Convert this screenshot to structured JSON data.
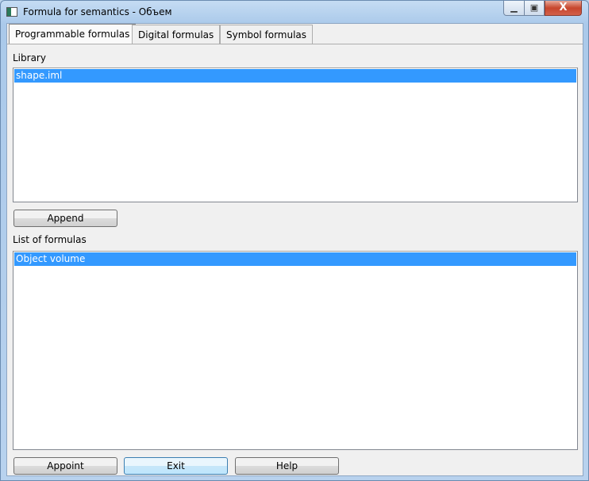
{
  "window": {
    "title": "Formula for semantics - Объем",
    "close_glyph": "X"
  },
  "tabs": [
    {
      "label": "Programmable formulas",
      "active": true
    },
    {
      "label": "Digital formulas"
    },
    {
      "label": "Symbol formulas"
    }
  ],
  "library": {
    "label": "Library",
    "items": [
      "shape.iml"
    ],
    "selected": "shape.iml",
    "append_label": "Append"
  },
  "formulas": {
    "label": "List of formulas",
    "items": [
      "Object volume"
    ],
    "selected": "Object volume"
  },
  "buttons": {
    "appoint": "Appoint",
    "exit": "Exit",
    "help": "Help"
  },
  "colors": {
    "selection": "#3399ff"
  }
}
